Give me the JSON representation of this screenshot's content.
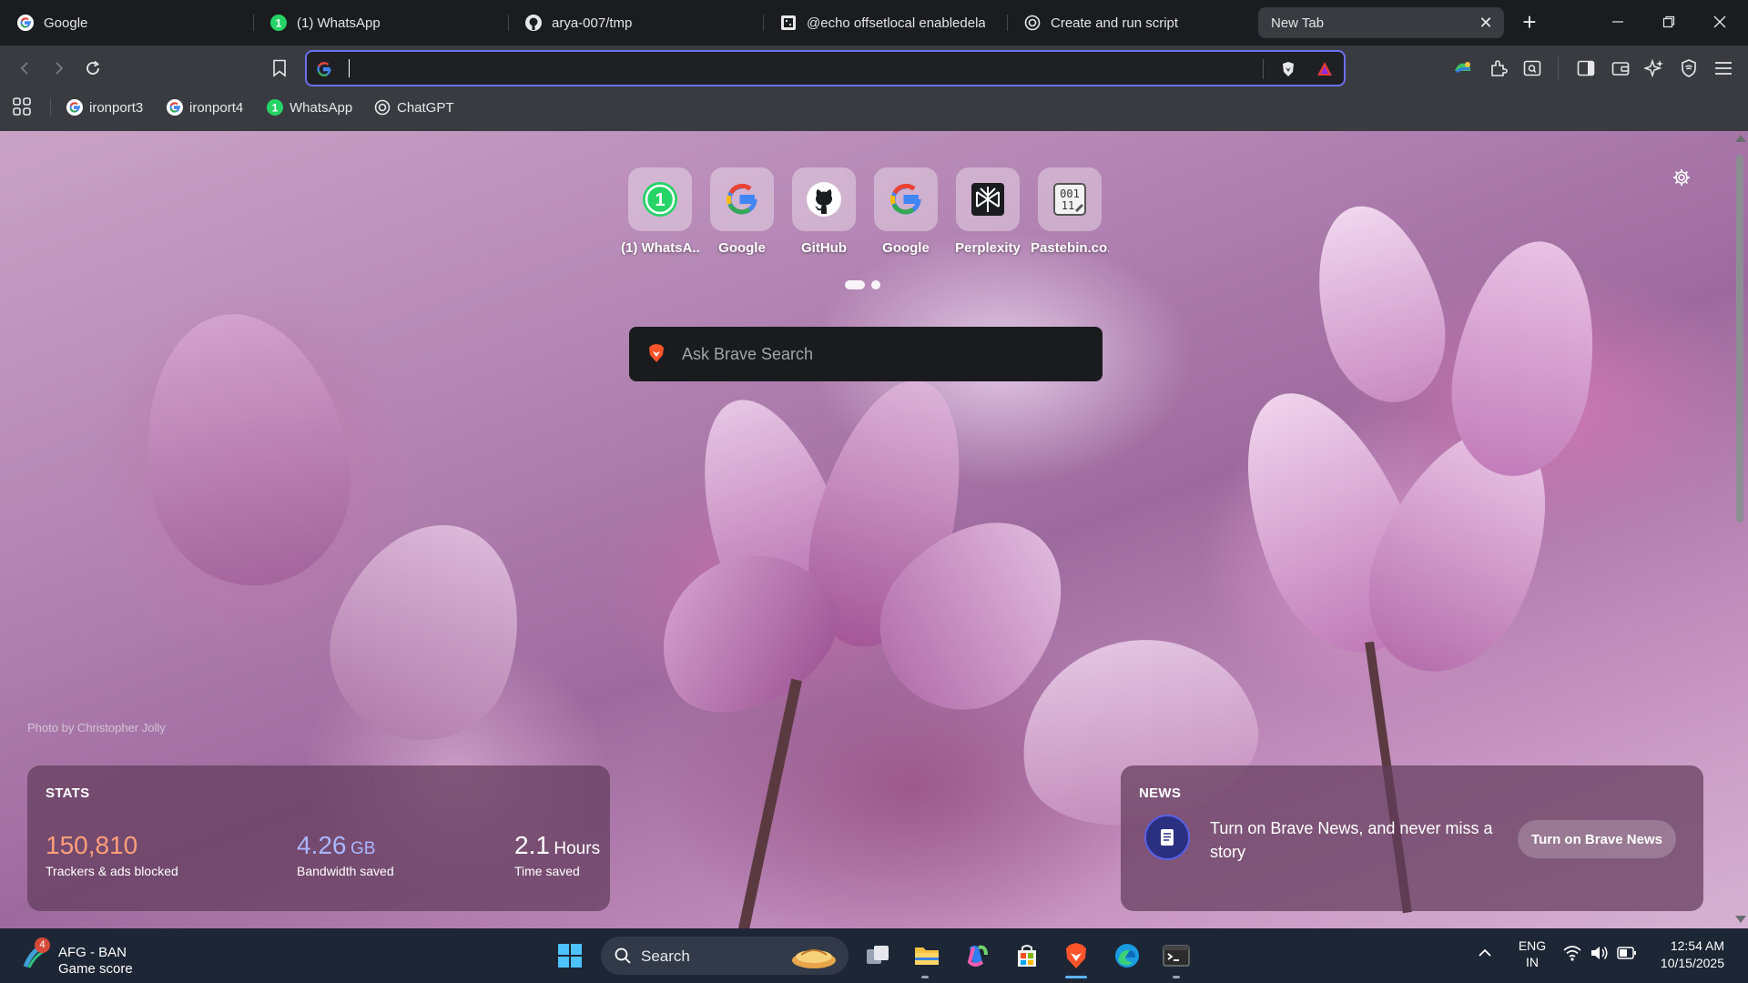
{
  "tabs": [
    {
      "label": "Google",
      "icon": "google-icon"
    },
    {
      "label": "(1) WhatsApp",
      "icon": "whatsapp-icon"
    },
    {
      "label": "arya-007/tmp",
      "icon": "github-icon"
    },
    {
      "label": "@echo offsetlocal enabledelaye",
      "icon": "pastebin-icon"
    },
    {
      "label": "Create and run script",
      "icon": "chatgpt-icon"
    },
    {
      "label": "New Tab",
      "icon": "",
      "active": true
    }
  ],
  "omnibox": {
    "value": "",
    "placeholder": ""
  },
  "bookmarks": [
    {
      "label": "ironport3",
      "icon": "google-icon"
    },
    {
      "label": "ironport4",
      "icon": "google-icon"
    },
    {
      "label": "WhatsApp",
      "icon": "whatsapp-icon"
    },
    {
      "label": "ChatGPT",
      "icon": "chatgpt-icon"
    }
  ],
  "top_sites": [
    {
      "label": "(1) WhatsA...",
      "icon": "whatsapp-icon"
    },
    {
      "label": "Google",
      "icon": "google-icon"
    },
    {
      "label": "GitHub",
      "icon": "github-icon"
    },
    {
      "label": "Google",
      "icon": "google-icon"
    },
    {
      "label": "Perplexity",
      "icon": "perplexity-icon"
    },
    {
      "label": "Pastebin.co...",
      "icon": "pastebin-icon"
    }
  ],
  "search": {
    "placeholder": "Ask Brave Search"
  },
  "photo_credit": "Photo by Christopher Jolly",
  "stats": {
    "title": "STATS",
    "trackers": {
      "value": "150,810",
      "label": "Trackers & ads blocked",
      "color": "#ff9f7a"
    },
    "bandwidth": {
      "value": "4.26",
      "unit": "GB",
      "label": "Bandwidth saved",
      "color": "#a9b6ff"
    },
    "time": {
      "value": "2.1",
      "unit": "Hours",
      "label": "Time saved",
      "color": "#ffffff"
    }
  },
  "news": {
    "title": "NEWS",
    "text": "Turn on Brave News, and never miss a story",
    "button": "Turn on Brave News"
  },
  "taskbar": {
    "weather_badge": "4",
    "weather_line1": "AFG - BAN",
    "weather_line2": "Game score",
    "search_label": "Search",
    "lang_line1": "ENG",
    "lang_line2": "IN",
    "time": "12:54 AM",
    "date": "10/15/2025"
  },
  "colors": {
    "accent": "#6a6ff0",
    "brave_orange": "#fb542b",
    "tab_active": "#3a3b40",
    "taskbar": "#1d2635"
  }
}
